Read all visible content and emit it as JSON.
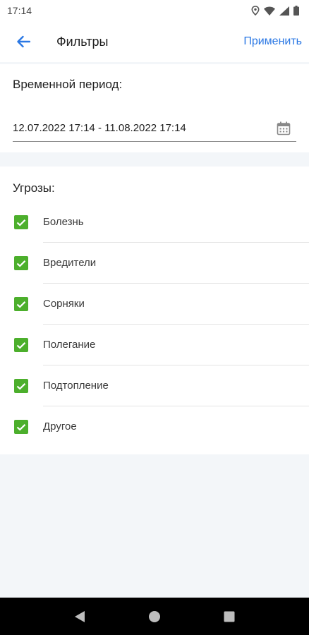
{
  "status_bar": {
    "time": "17:14",
    "icons": [
      "location-icon",
      "wifi-icon",
      "signal-icon",
      "battery-icon"
    ]
  },
  "app_bar": {
    "back_icon": "arrow-left-icon",
    "title": "Фильтры",
    "apply_label": "Применить"
  },
  "period": {
    "label": "Временной период:",
    "value": "12.07.2022 17:14 - 11.08.2022 17:14",
    "icon": "calendar-icon"
  },
  "threats": {
    "label": "Угрозы:",
    "items": [
      {
        "label": "Болезнь",
        "checked": true
      },
      {
        "label": "Вредители",
        "checked": true
      },
      {
        "label": "Сорняки",
        "checked": true
      },
      {
        "label": "Полегание",
        "checked": true
      },
      {
        "label": "Подтопление",
        "checked": true
      },
      {
        "label": "Другое",
        "checked": true
      }
    ]
  },
  "colors": {
    "accent": "#2b78e4",
    "checkbox": "#4caf2c",
    "background": "#f3f6f9"
  },
  "nav_bar": {
    "icons": [
      "back-triangle-icon",
      "home-circle-icon",
      "recents-square-icon"
    ]
  }
}
